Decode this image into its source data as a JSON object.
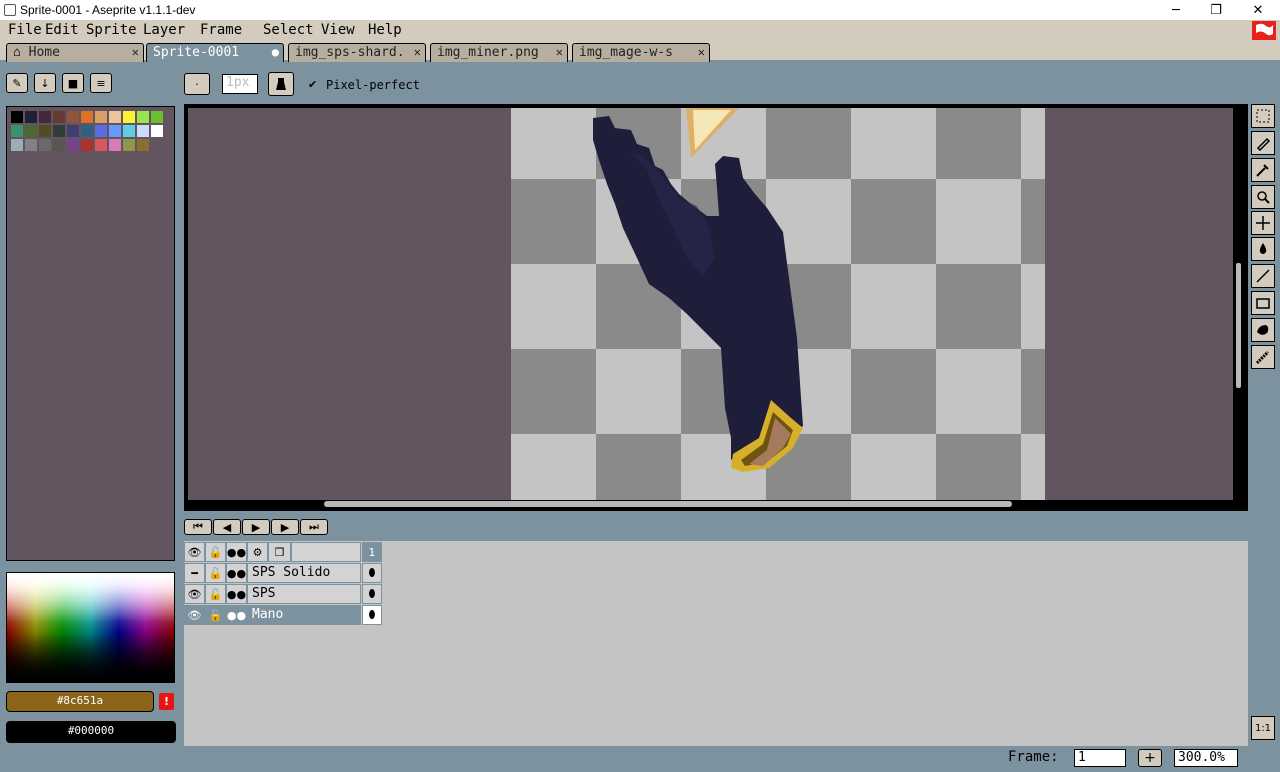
{
  "window": {
    "title": "Sprite-0001 - Aseprite v1.1.1-dev",
    "minimize": "─",
    "maximize": "❐",
    "close": "✕"
  },
  "menu": [
    "File",
    "Edit",
    "Sprite",
    "Layer",
    "Frame",
    "Select",
    "View",
    "Help"
  ],
  "tabs": [
    {
      "label": "Home",
      "close": "✕"
    },
    {
      "label": "Sprite-0001",
      "close": "●"
    },
    {
      "label": "img_sps-shard.",
      "close": "✕"
    },
    {
      "label": "img_miner.png",
      "close": "✕"
    },
    {
      "label": "img_mage-w-s",
      "close": "✕"
    }
  ],
  "context_bar": {
    "brush_size": "1px",
    "pixel_perfect_label": "Pixel-perfect",
    "pixel_perfect_checked": true
  },
  "palette": {
    "row1": [
      "#000000",
      "#222034",
      "#45283c",
      "#663931",
      "#8f563b",
      "#df7126",
      "#d9a066",
      "#eec39a",
      "#fbf236",
      "#99e550",
      "#6abe30"
    ],
    "row2": [
      "#37946e",
      "#4b692f",
      "#524b24",
      "#323c39",
      "#3f3f74",
      "#306082",
      "#5b6ee1",
      "#639bff",
      "#5fcde4",
      "#cbdbfc",
      "#ffffff"
    ],
    "row3": [
      "#9badb7",
      "#847e87",
      "#696a6a",
      "#595652",
      "#76428a",
      "#ac3232",
      "#d95763",
      "#d77bba",
      "#8f974a",
      "#8a6f30"
    ]
  },
  "colors": {
    "foreground": "#8c651a",
    "background": "#000000",
    "warning": "!"
  },
  "timeline": {
    "frame_numbers": [
      "1"
    ],
    "layers": [
      {
        "name": "SPS Solido",
        "selected": false
      },
      {
        "name": "SPS",
        "selected": false
      },
      {
        "name": "Mano",
        "selected": true
      }
    ]
  },
  "status": {
    "frame_label": "Frame:",
    "frame_value": "1",
    "add_frame": "+",
    "zoom": "300.0%",
    "ratio_button": "1:1"
  },
  "canvas_colors": {
    "glove": "#1e1d3a",
    "cuff_gold": "#d6b02b",
    "skin": "#a67a5c",
    "shard": "#f5e8b8"
  }
}
